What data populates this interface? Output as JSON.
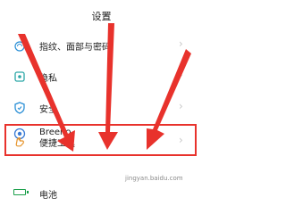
{
  "header": {
    "title": "设置"
  },
  "list": {
    "items": [
      {
        "label": "指纹、面部与密码",
        "icon": "fingerprint-icon"
      },
      {
        "label": "隐私",
        "icon": "privacy-icon"
      },
      {
        "label": "安全",
        "icon": "shield-icon"
      },
      {
        "label": "Breeno",
        "icon": "breeno-icon"
      },
      {
        "label": "便捷工具",
        "icon": "hand-tool-icon"
      },
      {
        "label": "电池",
        "icon": "battery-icon"
      }
    ]
  },
  "annotations": {
    "arrow_color": "#e8322c",
    "highlight_color": "#e8322c"
  },
  "watermark": "jingyan.baidu.com"
}
